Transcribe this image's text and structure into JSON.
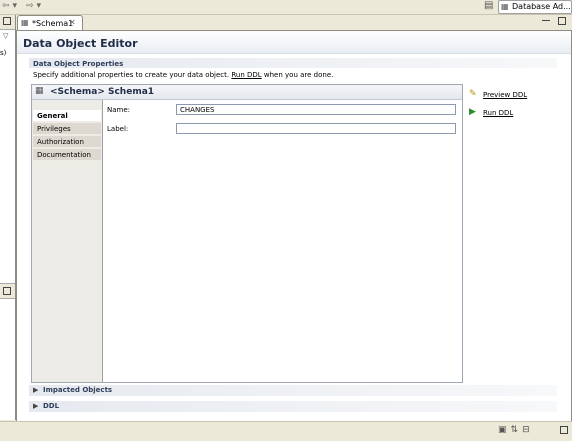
{
  "toolbar": {
    "icons": [
      "back-icon",
      "forward-icon"
    ],
    "perspective_label": "Database Ad..."
  },
  "left_panel": {
    "visible_text": "s)"
  },
  "editor_tab": {
    "label": "*Schema1"
  },
  "editor": {
    "title": "Data Object Editor",
    "section_title": "Data Object Properties",
    "section_desc_prefix": "Specify additional properties to create your data object.",
    "section_desc_link": "Run DDL",
    "section_desc_suffix": "when you are done.",
    "schema_title": "<Schema> Schema1",
    "tabs": [
      {
        "label": "General",
        "active": true
      },
      {
        "label": "Privileges",
        "active": false
      },
      {
        "label": "Authorization",
        "active": false
      },
      {
        "label": "Documentation",
        "active": false
      }
    ],
    "fields": {
      "name_label": "Name:",
      "name_value": "CHANGES",
      "label_label": "Label:",
      "label_value": ""
    },
    "actions": {
      "preview_ddl": "Preview DDL",
      "run_ddl": "Run DDL"
    },
    "collapsed_sections": [
      "Impacted Objects",
      "DDL"
    ]
  },
  "colors": {
    "title_text": "#1f2d48",
    "section_header": "#30405a",
    "chrome_bg": "#ece9d8"
  }
}
